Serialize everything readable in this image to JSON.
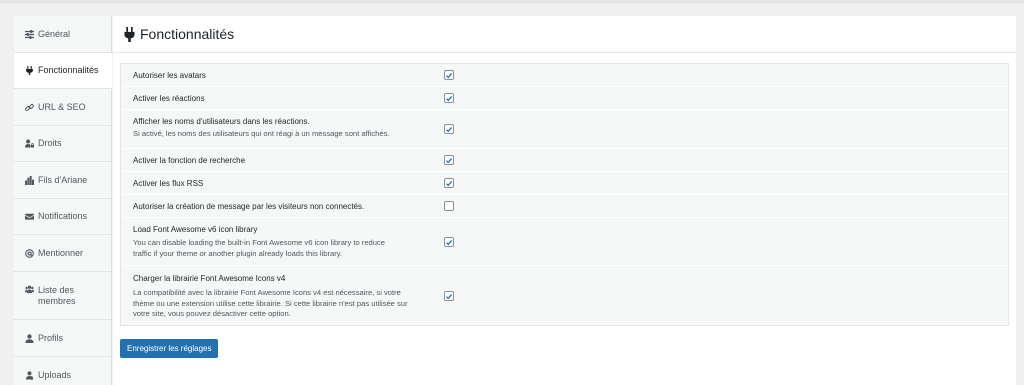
{
  "sidebar": {
    "items": [
      {
        "label": "Général",
        "icon": "sliders-icon"
      },
      {
        "label": "Fonctionnalités",
        "icon": "plug-icon"
      },
      {
        "label": "URL & SEO",
        "icon": "link-icon"
      },
      {
        "label": "Droits",
        "icon": "user-lock-icon"
      },
      {
        "label": "Fils d'Ariane",
        "icon": "chart-icon"
      },
      {
        "label": "Notifications",
        "icon": "envelope-icon"
      },
      {
        "label": "Mentionner",
        "icon": "at-icon"
      },
      {
        "label": "Liste des\nmembres",
        "icon": "users-icon"
      },
      {
        "label": "Profils",
        "icon": "user-icon"
      },
      {
        "label": "Uploads",
        "icon": "upload-icon"
      }
    ],
    "active_index": 1
  },
  "header": {
    "title": "Fonctionnalités"
  },
  "settings": [
    {
      "title": "Autoriser les avatars",
      "description": "",
      "checked": true
    },
    {
      "title": "Activer les réactions",
      "description": "",
      "checked": true
    },
    {
      "title": "Afficher les noms d'utilisateurs dans les réactions.",
      "description": "Si activé, les noms des utilisateurs qui ont réagi à un message sont affichés.",
      "checked": true
    },
    {
      "title": "Activer la fonction de recherche",
      "description": "",
      "checked": true
    },
    {
      "title": "Activer les flux RSS",
      "description": "",
      "checked": true
    },
    {
      "title": "Autoriser la création de message par les visiteurs non connectés.",
      "description": "",
      "checked": false
    },
    {
      "title": "Load Font Awesome v6 icon library",
      "description": "You can disable loading the built-in Font Awesome v6 icon library to reduce traffic if your theme or another plugin already loads this library.",
      "checked": true
    },
    {
      "title": "Charger la librairie Font Awesome Icons v4",
      "description": "La compatibilité avec la librairie Font Awesome Icons v4 est nécessaire, si votre thème ou une extension utilise cette librairie. Si cette librairie n'est pas utilisée sur votre site, vous pouvez désactiver cette option.",
      "checked": true
    }
  ],
  "actions": {
    "save_label": "Enregistrer les réglages"
  },
  "colors": {
    "accent": "#2271b1",
    "background": "#f0f0f1",
    "panel": "#ffffff"
  }
}
